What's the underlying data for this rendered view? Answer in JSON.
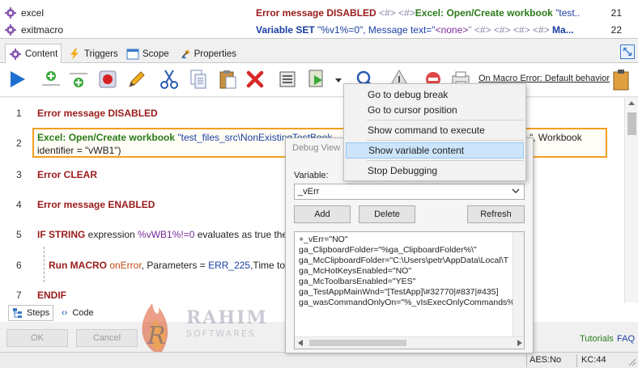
{
  "macro_list": {
    "rows": [
      {
        "name": "excel",
        "segments": [
          {
            "t": "Error message DISABLED",
            "c": "kw-red"
          },
          {
            "t": " <#> <#>",
            "c": "kw-gray"
          },
          {
            "t": "Excel: Open/Create workbook",
            "c": "kw-green"
          },
          {
            "t": " \"test...",
            "c": "kw-str"
          }
        ],
        "number": "21"
      },
      {
        "name": "exitmacro",
        "segments": [
          {
            "t": "Variable SET",
            "c": "kw-blue"
          },
          {
            "t": " \"%v1%=0\", Message text=\"",
            "c": "kw-str"
          },
          {
            "t": "<none>",
            "c": "kw-purple"
          },
          {
            "t": "\" <#> <#> <#> <#> ",
            "c": "kw-gray"
          },
          {
            "t": "Ma...",
            "c": "kw-blue"
          }
        ],
        "number": "22"
      }
    ]
  },
  "tabs": [
    {
      "label": "Content",
      "active": true
    },
    {
      "label": "Triggers",
      "active": false
    },
    {
      "label": "Scope",
      "active": false
    },
    {
      "label": "Properties",
      "active": false
    }
  ],
  "toolbar": {
    "icons": [
      "play-icon",
      "add-command-icon",
      "insert-command-icon",
      "record-icon",
      "edit-icon",
      "cut-icon",
      "copy-icon",
      "paste-icon",
      "delete-icon",
      "disable-icon",
      "debug-icon",
      "debug-dropdown-icon",
      "search-icon",
      "warning-icon",
      "no-entry-icon",
      "printer-icon",
      "clipboard-icon"
    ],
    "on_error_label": "On Macro Error: Default behavior"
  },
  "editor": {
    "lines": [
      {
        "num": "1",
        "segments": [
          {
            "t": "Error message DISABLED",
            "c": "kw-red"
          }
        ]
      },
      {
        "num": "2",
        "segments": [
          {
            "t": "Excel: Open/Create workbook",
            "c": "kw-green"
          },
          {
            "t": " \"test_files_src\\NonExistingTestBook",
            "c": "kw-str"
          }
        ],
        "right": "\", Workbook",
        "wrap": "identifier = \"vWB1\")"
      },
      {
        "num": "3",
        "segments": [
          {
            "t": "Error CLEAR",
            "c": "kw-red"
          }
        ]
      },
      {
        "num": "4",
        "segments": [
          {
            "t": "Error message ENABLED",
            "c": "kw-red"
          }
        ]
      },
      {
        "num": "5",
        "segments": [
          {
            "t": "IF STRING",
            "c": "kw-red"
          },
          {
            "t": " expression ",
            "c": "kw-plain"
          },
          {
            "t": "%vWB1%!=0",
            "c": "kw-purple"
          },
          {
            "t": " evaluates as true then",
            "c": "kw-plain"
          }
        ]
      },
      {
        "num": "6",
        "segments": [
          {
            "t": "Run MACRO",
            "c": "kw-red"
          },
          {
            "t": " onError",
            "c": "kw-orange"
          },
          {
            "t": ", Parameters = ",
            "c": "kw-plain"
          },
          {
            "t": "ERR_225",
            "c": "kw-str"
          },
          {
            "t": ",Time to w",
            "c": "kw-plain"
          }
        ]
      },
      {
        "num": "7",
        "segments": [
          {
            "t": "ENDIF",
            "c": "kw-red"
          }
        ]
      }
    ]
  },
  "bottom_tabs": [
    {
      "label": "Steps",
      "active": true
    },
    {
      "label": "Code",
      "active": false
    }
  ],
  "footer": {
    "ok_label": "OK",
    "cancel_label": "Cancel",
    "tutorials_label": "Tutorials",
    "faq_label": "FAQ"
  },
  "statusbar": {
    "caps": "AES:No",
    "keycode": "KC:44"
  },
  "debug_view": {
    "title": "Debug View",
    "variable_label": "Variable:",
    "variable_value": "_vErr",
    "add_label": "Add",
    "delete_label": "Delete",
    "refresh_label": "Refresh",
    "content_lines": [
      "+_vErr=\"NO\"",
      "ga_ClipboardFolder=\"%ga_ClipboardFolder%\\\"",
      "ga_McClipboardFolder=\"C:\\Users\\petr\\AppData\\Local\\T",
      "ga_McHotKeysEnabled=\"NO\"",
      "ga_McToolbarsEnabled=\"YES\"",
      "ga_TestAppMainWnd=\"[TestApp]\\#32770|#837|#435]",
      "ga_wasCommandOnlyOn=\"%_vIsExecOnlyCommands%"
    ]
  },
  "context_menu": {
    "items": [
      {
        "label": "Go to debug break",
        "highlighted": false
      },
      {
        "label": "Go to cursor position",
        "highlighted": false
      },
      {
        "label": "Show command to execute",
        "highlighted": false
      },
      {
        "label": "Show variable content",
        "highlighted": true
      },
      {
        "label": "Stop Debugging",
        "highlighted": false
      }
    ]
  },
  "watermark": {
    "brand": "RAHIM",
    "tagline": "SOFTWARES"
  },
  "colors": {
    "highlight_border": "#f0a020",
    "menu_highlight": "#cce5fb",
    "keyword_red": "#9a1a1a",
    "keyword_blue": "#1b3fa3",
    "keyword_green": "#2a7a1a"
  }
}
